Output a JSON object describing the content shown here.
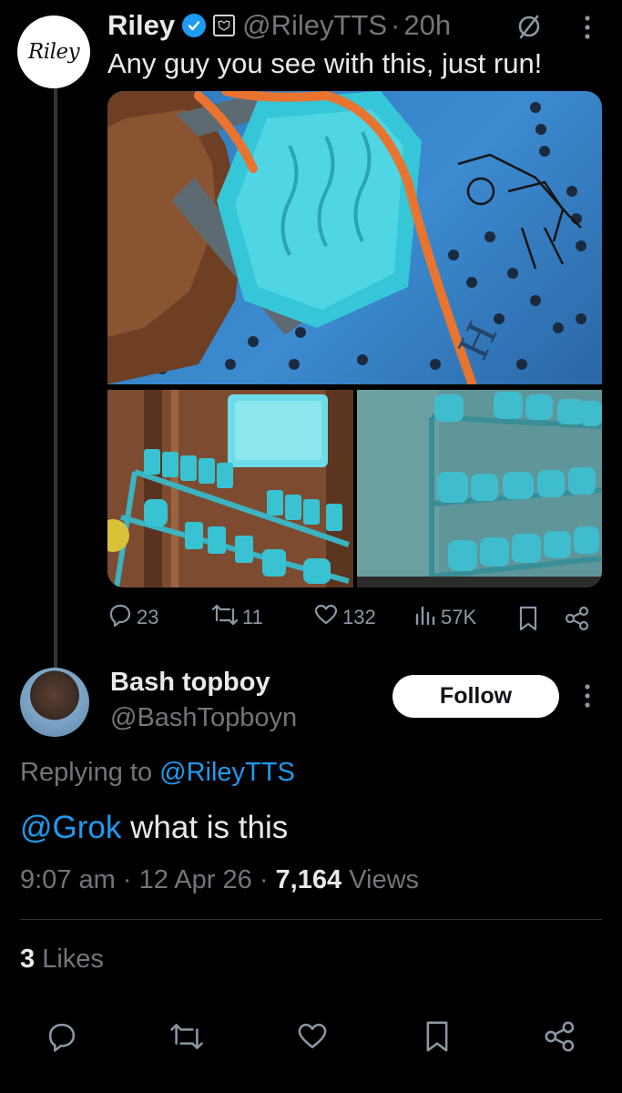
{
  "tweet": {
    "avatar_text": "Riley",
    "author_name": "Riley",
    "handle": "@RileyTTS",
    "separator": "·",
    "time": "20h",
    "text": "Any guy you see with this, just run!",
    "stats": {
      "replies": "23",
      "reposts": "11",
      "likes": "132",
      "views": "57K"
    }
  },
  "reply": {
    "author_name": "Bash topboy",
    "handle": "@BashTopboyn",
    "follow_label": "Follow",
    "replying_to_label": "Replying to",
    "replying_to_handle": "@RileyTTS",
    "mention": "@Grok",
    "text": "what is this",
    "time": "9:07 am",
    "sep1": "·",
    "date": "12 Apr 26",
    "sep2": "·",
    "views_count": "7,164",
    "views_label": "Views",
    "likes_count": "3",
    "likes_label": "Likes"
  },
  "colors": {
    "background": "#000000",
    "text": "#e7e9ea",
    "muted": "#71767b",
    "link": "#1d9bf0",
    "verified": "#1d9bf0"
  },
  "icons": [
    "verified-badge-icon",
    "affiliate-badge-icon",
    "grok-slash-icon",
    "more-icon",
    "reply-icon",
    "repost-icon",
    "like-icon",
    "views-icon",
    "bookmark-icon",
    "share-icon"
  ]
}
